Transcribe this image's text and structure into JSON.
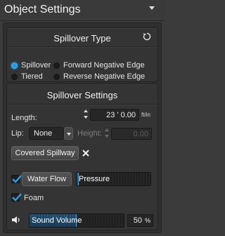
{
  "panel": {
    "title": "Object Settings"
  },
  "spillover_type": {
    "title": "Spillover Type",
    "options": [
      {
        "label": "Spillover",
        "selected": true
      },
      {
        "label": "Forward Negative Edge",
        "selected": false
      },
      {
        "label": "Tiered",
        "selected": false
      },
      {
        "label": "Reverse Negative Edge",
        "selected": false
      }
    ]
  },
  "spillover_settings": {
    "title": "Spillover Settings",
    "length": {
      "label": "Length:",
      "value": "23 ' 0.00",
      "unit": "ft/in"
    },
    "lip": {
      "label": "Lip:",
      "value": "None"
    },
    "height": {
      "label": "Height:",
      "value": "0.00"
    },
    "covered_spillway": {
      "label": "Covered Spillway"
    },
    "water_flow": {
      "label": "Water Flow",
      "checked": true
    },
    "pressure": {
      "label": "Pressure",
      "level": 0.03
    },
    "foam": {
      "label": "Foam",
      "checked": true
    },
    "sound_volume": {
      "label": "Sound Volume",
      "level": 0.5,
      "value": "50",
      "unit": "%"
    }
  },
  "colors": {
    "accent": "#1f9be8",
    "panel_bg": "#3b3b3b",
    "section_bg": "#343434"
  }
}
